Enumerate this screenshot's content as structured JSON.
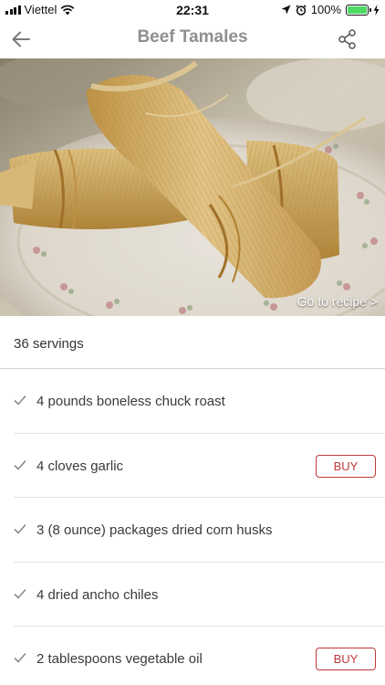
{
  "status_bar": {
    "carrier": "Viettel",
    "time": "22:31",
    "battery": "100%"
  },
  "header": {
    "title": "Beef Tamales"
  },
  "hero": {
    "link_label": "Go to recipe >"
  },
  "servings": "36 servings",
  "ingredients": [
    {
      "text": "4 pounds boneless chuck roast",
      "buy_label": ""
    },
    {
      "text": "4 cloves garlic",
      "buy_label": "BUY"
    },
    {
      "text": "3 (8 ounce) packages dried corn husks",
      "buy_label": ""
    },
    {
      "text": "4 dried ancho chiles",
      "buy_label": ""
    },
    {
      "text": "2 tablespoons vegetable oil",
      "buy_label": "BUY"
    }
  ],
  "colors": {
    "accent": "#c0393b",
    "title_gray": "#8f8f8f",
    "battery_green": "#4cd964"
  },
  "icons": {
    "back": "arrow-left-icon",
    "share": "share-icon",
    "check": "checkmark-icon",
    "wifi": "wifi-icon",
    "location": "location-arrow-icon",
    "alarm": "alarm-clock-icon",
    "charging": "bolt-icon"
  }
}
